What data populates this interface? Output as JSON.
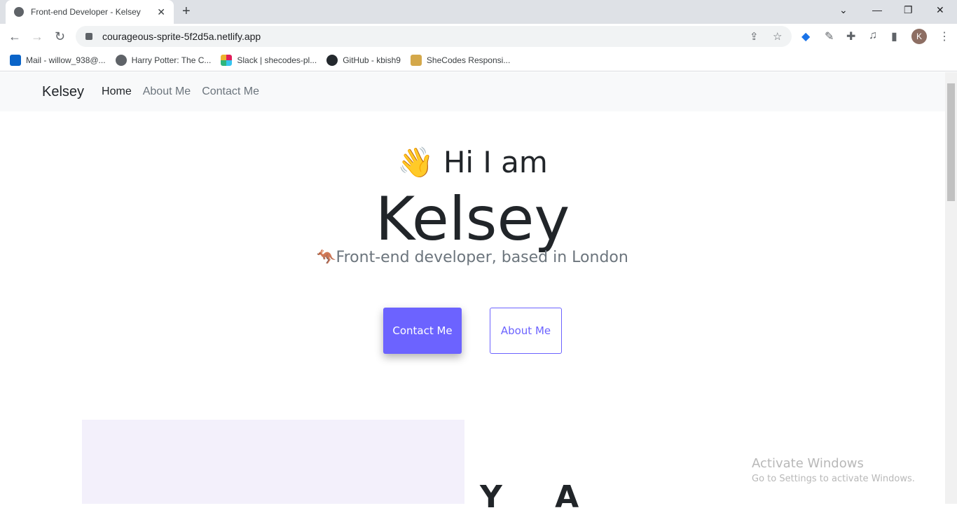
{
  "browser": {
    "tab_title": "Front-end Developer - Kelsey",
    "url": "courageous-sprite-5f2d5a.netlify.app",
    "profile_initial": "K",
    "bookmarks": [
      {
        "label": "Mail - willow_938@...",
        "color": "#0a64c8"
      },
      {
        "label": "Harry Potter: The C...",
        "color": "#5f6368"
      },
      {
        "label": "Slack | shecodes-pl...",
        "color": "#e01e5a"
      },
      {
        "label": "GitHub - kbish9",
        "color": "#24292e"
      },
      {
        "label": "SheCodes Responsi...",
        "color": "#d4a84a"
      }
    ]
  },
  "navbar": {
    "brand": "Kelsey",
    "links": [
      "Home",
      "About Me",
      "Contact Me"
    ]
  },
  "hero": {
    "greeting": "👋 Hi I am",
    "name": "Kelsey",
    "subtitle": "🦘Front-end developer, based in London",
    "contact_button": "Contact Me",
    "about_button": "About Me",
    "accent_color": "#6c63ff"
  },
  "section": {
    "heading_partial": "Y A"
  },
  "watermark": {
    "title": "Activate Windows",
    "subtitle": "Go to Settings to activate Windows."
  }
}
